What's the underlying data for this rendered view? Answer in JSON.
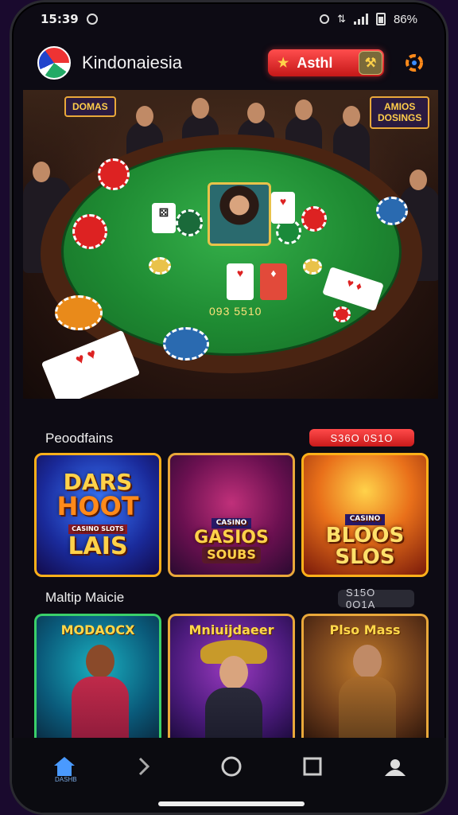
{
  "status_bar": {
    "time": "15:39",
    "battery": "86%"
  },
  "header": {
    "app_name": "Kindonaiesia",
    "button_label": "Asthl",
    "icon_left": "star-icon",
    "icon_right": "wallet-icon"
  },
  "hero": {
    "left_sign": "DOMAS",
    "right_sign_line1": "AMIOS",
    "right_sign_line2": "DOSINGS",
    "table_amount": "093 5510"
  },
  "section1": {
    "title": "Peoodfains",
    "tag": "S36O 0S1O",
    "tiles": [
      {
        "line1": "DARS",
        "line2": "HOOT",
        "line3": "LAIS",
        "small": "CASINO SLOTS"
      },
      {
        "line1": "GASIOS",
        "line2": "SOUBS",
        "small": "CASINO"
      },
      {
        "line1": "BLOOS",
        "line2": "SLOS",
        "small": "CASINO"
      }
    ]
  },
  "section2": {
    "title": "Maltip Maicie",
    "tag": "S15O 0O1A",
    "tiles": [
      {
        "label": "MODAOCX"
      },
      {
        "label": "Mniuijdaeer"
      },
      {
        "label": "Plso Mass"
      }
    ]
  },
  "navbar": {
    "home_label": "DASHB",
    "items": [
      "home-icon",
      "back-icon",
      "circle-icon",
      "square-icon",
      "profile-icon"
    ]
  }
}
